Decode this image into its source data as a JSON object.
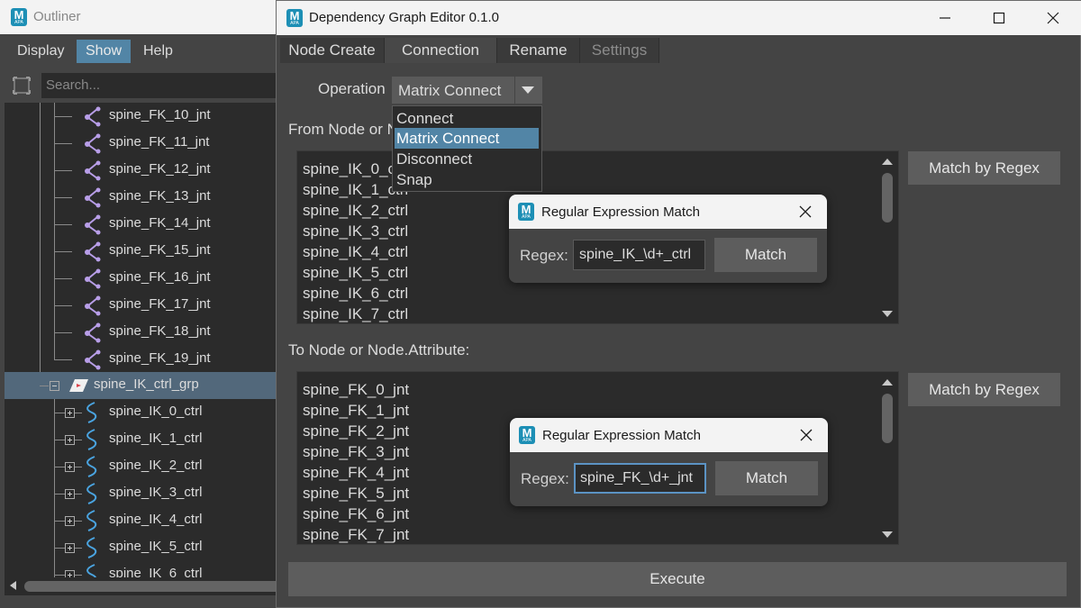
{
  "outliner": {
    "title": "Outliner",
    "menu": [
      "Display",
      "Show",
      "Help"
    ],
    "search_placeholder": "Search...",
    "fk_joints": [
      "spine_FK_10_jnt",
      "spine_FK_11_jnt",
      "spine_FK_12_jnt",
      "spine_FK_13_jnt",
      "spine_FK_14_jnt",
      "spine_FK_15_jnt",
      "spine_FK_16_jnt",
      "spine_FK_17_jnt",
      "spine_FK_18_jnt",
      "spine_FK_19_jnt"
    ],
    "group_label": "spine_IK_ctrl_grp",
    "ik_ctrls": [
      "spine_IK_0_ctrl",
      "spine_IK_1_ctrl",
      "spine_IK_2_ctrl",
      "spine_IK_3_ctrl",
      "spine_IK_4_ctrl",
      "spine_IK_5_ctrl",
      "spine_IK_6_ctrl"
    ]
  },
  "editor": {
    "title": "Dependency Graph Editor 0.1.0",
    "tabs": [
      "Node Create",
      "Connection",
      "Rename",
      "Settings"
    ],
    "operation_label": "Operation",
    "operation_value": "Matrix Connect",
    "operation_options": [
      "Connect",
      "Matrix Connect",
      "Disconnect",
      "Snap"
    ],
    "from_label": "From Node or N",
    "from_items": [
      "spine_IK_0_ctrl",
      "spine_IK_1_ctrl",
      "spine_IK_2_ctrl",
      "spine_IK_3_ctrl",
      "spine_IK_4_ctrl",
      "spine_IK_5_ctrl",
      "spine_IK_6_ctrl",
      "spine_IK_7_ctrl"
    ],
    "to_label": "To Node or Node.Attribute:",
    "to_items": [
      "spine_FK_0_jnt",
      "spine_FK_1_jnt",
      "spine_FK_2_jnt",
      "spine_FK_3_jnt",
      "spine_FK_4_jnt",
      "spine_FK_5_jnt",
      "spine_FK_6_jnt",
      "spine_FK_7_jnt"
    ],
    "match_regex_label": "Match by Regex",
    "execute_label": "Execute"
  },
  "regex_dialogs": [
    {
      "title": "Regular Expression Match",
      "label": "Regex:",
      "value": "spine_IK_\\d+_ctrl",
      "button": "Match"
    },
    {
      "title": "Regular Expression Match",
      "label": "Regex:",
      "value": "spine_FK_\\d+_jnt",
      "button": "Match"
    }
  ],
  "app_logo": {
    "letter": "M",
    "sub": "APA"
  },
  "colors": {
    "accent": "#5285a6",
    "joint_icon": "#b89ee8",
    "ik_curve_icon": "#4aa3df",
    "logo": "#1d8fb5"
  },
  "icons": [
    "filter-icon",
    "joint-icon",
    "curve-icon",
    "group-icon",
    "minimize-icon",
    "maximize-icon",
    "close-icon",
    "dropdown-arrow-icon"
  ]
}
